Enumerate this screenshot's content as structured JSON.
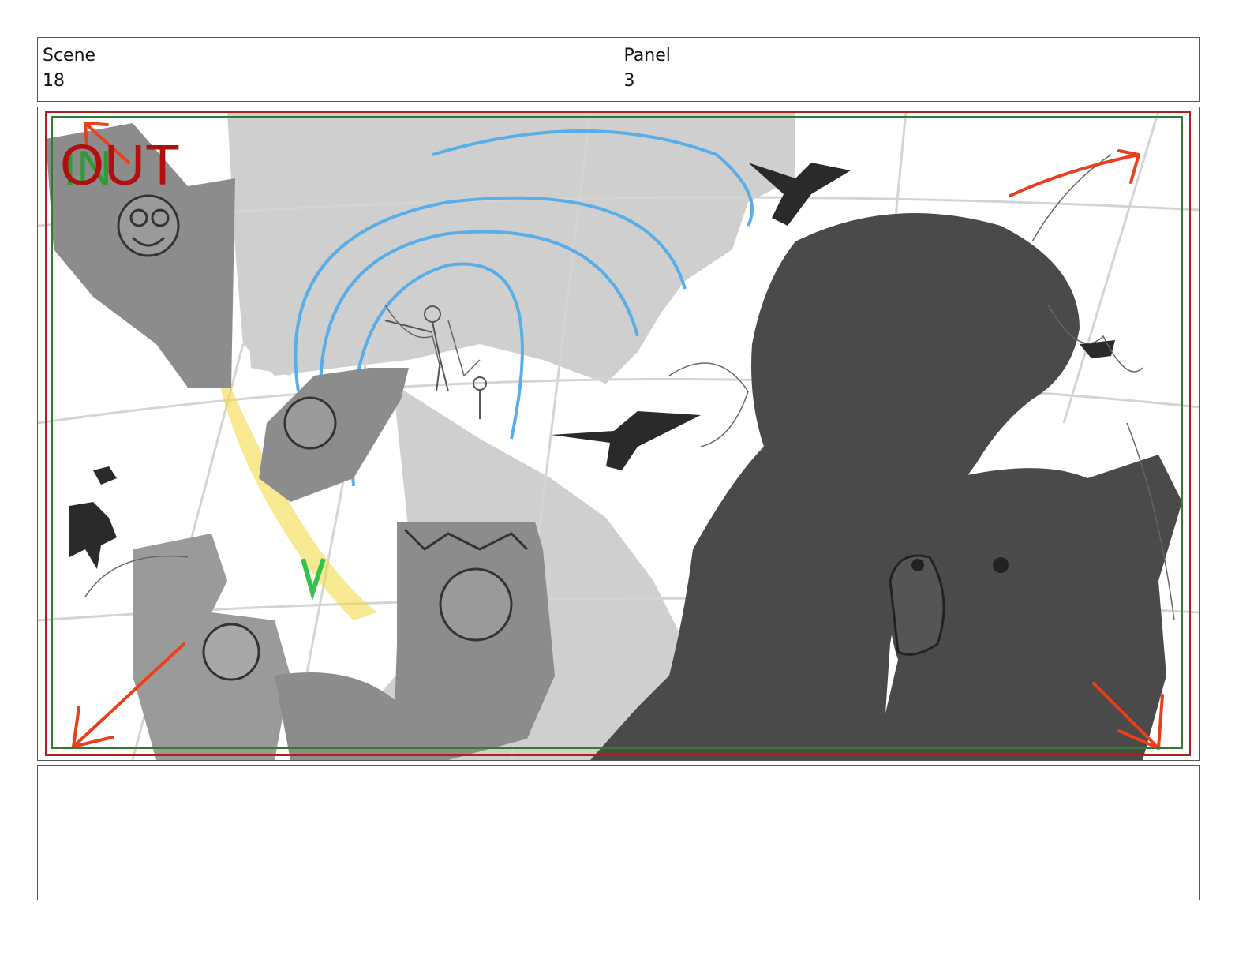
{
  "header": {
    "scene_label": "Scene",
    "scene_value": "18",
    "panel_label": "Panel",
    "panel_value": "3"
  },
  "panel": {
    "transition_in_text": "IN",
    "transition_out_text": "OUT",
    "colors": {
      "frame_red": "#b02020",
      "safe_green": "#2e7d32",
      "arrow_orange": "#e8401c",
      "dark_fill": "#4a4a4a",
      "mid_fill": "#8c8c8c",
      "light_fill": "#cfcfcf",
      "blue_lines": "#5aaee8",
      "sparkle_yellow": "#f2d636",
      "green_mark": "#36c24a"
    }
  },
  "notes": {
    "text": ""
  }
}
